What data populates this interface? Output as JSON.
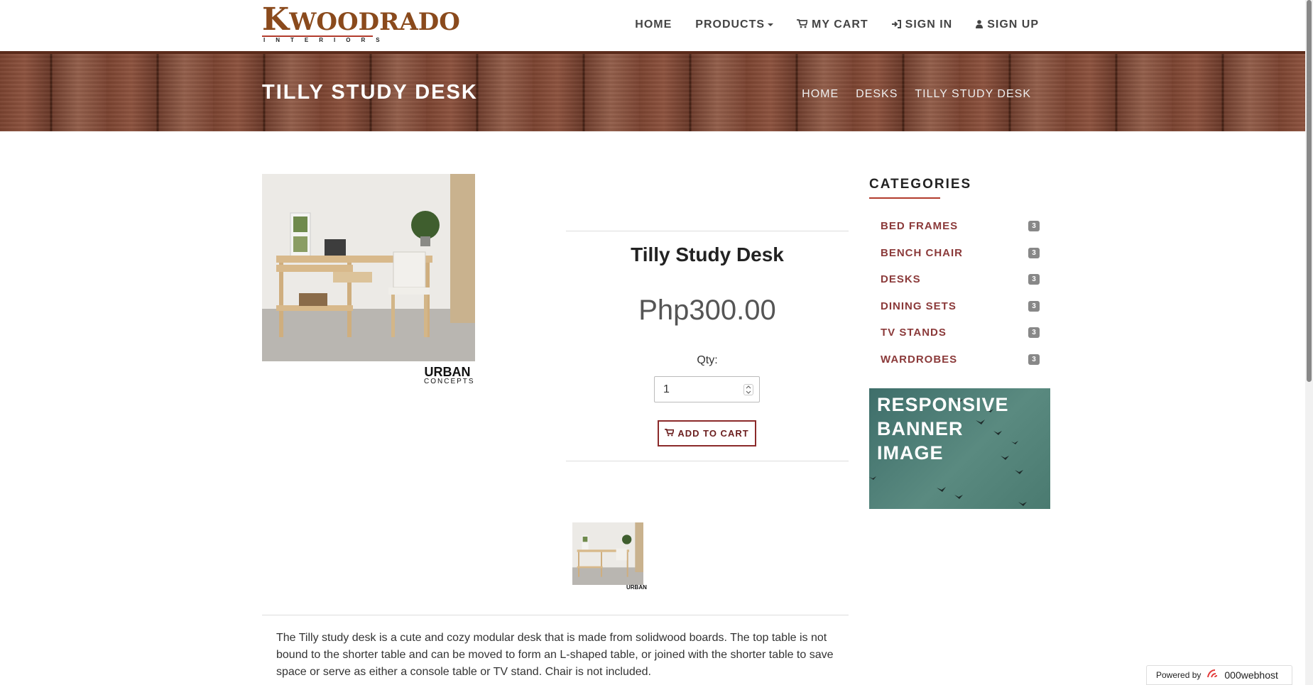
{
  "brand": {
    "logo_text": "KWOODRADO",
    "logo_sub": "INTERIORS"
  },
  "nav": {
    "items": [
      {
        "label": "HOME",
        "icon": ""
      },
      {
        "label": "PRODUCTS",
        "icon": ""
      },
      {
        "label": "MY CART",
        "icon": "shopping-cart-icon"
      },
      {
        "label": "SIGN IN",
        "icon": "sign-in-icon"
      },
      {
        "label": "SIGN UP",
        "icon": "user-icon"
      }
    ]
  },
  "banner": {
    "title": "TILLY STUDY DESK",
    "breadcrumbs": [
      "HOME",
      "DESKS",
      "TILLY STUDY DESK"
    ]
  },
  "product": {
    "name": "Tilly Study Desk",
    "price": "Php300.00",
    "qty_label": "Qty:",
    "qty_value": "1",
    "add_to_cart_label": "ADD TO CART",
    "image_logo_top": "URBAN",
    "image_logo_bottom": "CONCEPTS",
    "thumb_logo": "URBAN",
    "description": "The Tilly study desk is a cute and cozy modular desk that is made from solidwood boards. The top table is not bound to the shorter table and can be moved to form an L-shaped table, or joined with the shorter table to save space or serve as either a console table or TV stand. Chair is not included."
  },
  "sidebar": {
    "categories_title": "CATEGORIES",
    "categories": [
      {
        "name": "BED FRAMES",
        "count": "3"
      },
      {
        "name": "BENCH CHAIR",
        "count": "3"
      },
      {
        "name": "DESKS",
        "count": "3"
      },
      {
        "name": "DINING SETS",
        "count": "3"
      },
      {
        "name": "TV STANDS",
        "count": "3"
      },
      {
        "name": "WARDROBES",
        "count": "3"
      }
    ],
    "banner_text_1": "RESPONSIVE",
    "banner_text_2": "BANNER",
    "banner_text_3": "IMAGE"
  },
  "footer": {
    "powered_by": "Powered by",
    "host": "000webhost"
  },
  "colors": {
    "accent": "#8b3a3a",
    "underline": "#b23b2c",
    "badge": "#888888"
  }
}
